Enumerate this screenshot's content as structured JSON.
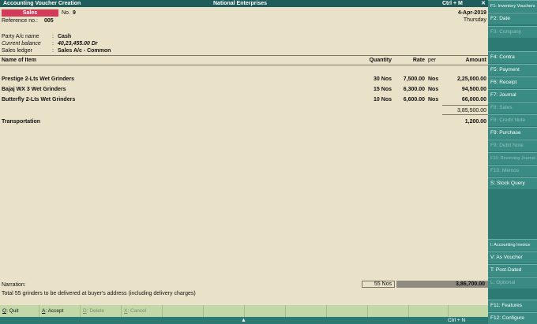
{
  "titlebar": {
    "left": "Accounting Voucher  Creation",
    "center": "National Enterprises",
    "right": "Ctrl + M",
    "close": "✕"
  },
  "voucher": {
    "type": "Sales",
    "number_label": "No.",
    "number": "9",
    "reference_label": "Reference no.:",
    "reference": "005",
    "date": "4-Apr-2019",
    "day": "Thursday"
  },
  "party": {
    "name_label": "Party A/c name",
    "name_value": "Cash",
    "balance_label": "Current balance",
    "balance_value": "40,23,455.00 Dr",
    "ledger_label": "Sales ledger",
    "ledger_value": "Sales A/c - Common",
    "colon": ":"
  },
  "table": {
    "headers": {
      "item": "Name of Item",
      "quantity": "Quantity",
      "rate": "Rate",
      "per": "per",
      "amount": "Amount"
    },
    "rows": [
      {
        "item": "Prestige 2-Lts Wet Grinders",
        "quantity": "30 Nos",
        "rate": "7,500.00",
        "per": "Nos",
        "amount": "2,25,000.00"
      },
      {
        "item": "Bajaj WX 3 Wet Grinders",
        "quantity": "15 Nos",
        "rate": "6,300.00",
        "per": "Nos",
        "amount": "94,500.00"
      },
      {
        "item": "Butterfly 2-Lts Wet Grinders",
        "quantity": "10 Nos",
        "rate": "6,600.00",
        "per": "Nos",
        "amount": "66,000.00"
      }
    ],
    "subtotal": "3,85,500.00",
    "additional": {
      "item": "Transportation",
      "amount": "1,200.00"
    }
  },
  "narration": {
    "label": "Narration:",
    "text": "Total 55 grinders to be delivered at buyer's address (including delivery charges)",
    "total_quantity": "55 Nos",
    "grand_total": "3,86,700.00"
  },
  "bottom_buttons": [
    {
      "key": "Q",
      "label": ": Quit",
      "enabled": true
    },
    {
      "key": "A",
      "label": ": Accept",
      "enabled": true
    },
    {
      "key": "D",
      "label": ": Delete",
      "enabled": false
    },
    {
      "key": "X",
      "label": ": Cancel",
      "enabled": false
    }
  ],
  "statusbar": {
    "arrow": "▲",
    "shortcut": "Ctrl + N"
  },
  "right_panel": {
    "buttons": [
      {
        "key": "F1",
        "label": ": Inventory Vouchers",
        "enabled": true
      },
      {
        "key": "F2",
        "label": ": Date",
        "enabled": true
      },
      {
        "key": "F3",
        "label": ": Company",
        "enabled": false
      },
      {
        "key": "F4",
        "label": ": Contra",
        "enabled": true
      },
      {
        "key": "F5",
        "label": ": Payment",
        "enabled": true
      },
      {
        "key": "F6",
        "label": ": Receipt",
        "enabled": true
      },
      {
        "key": "F7",
        "label": ": Journal",
        "enabled": true
      },
      {
        "key": "F8",
        "label": ": Sales",
        "enabled": false
      },
      {
        "key": "F8",
        "label": ": Credit Note",
        "enabled": false
      },
      {
        "key": "F9",
        "label": ": Purchase",
        "enabled": true
      },
      {
        "key": "F9",
        "label": ": Debit Note",
        "enabled": false
      },
      {
        "key": "F10",
        "label": ": Reversing Journal",
        "enabled": false
      },
      {
        "key": "F10",
        "label": ": Memos",
        "enabled": false
      },
      {
        "key": "S",
        "label": ": Stock Query",
        "enabled": true
      },
      {
        "key": "I",
        "label": ": Accounting Invoice",
        "enabled": true
      },
      {
        "key": "V",
        "label": ": As Voucher",
        "enabled": true
      },
      {
        "key": "T",
        "label": ": Post-Dated",
        "enabled": true
      },
      {
        "key": "L",
        "label": ": Optional",
        "enabled": false
      },
      {
        "key": "F11",
        "label": ": Features",
        "enabled": true
      },
      {
        "key": "F12",
        "label": ": Configure",
        "enabled": true
      }
    ]
  }
}
